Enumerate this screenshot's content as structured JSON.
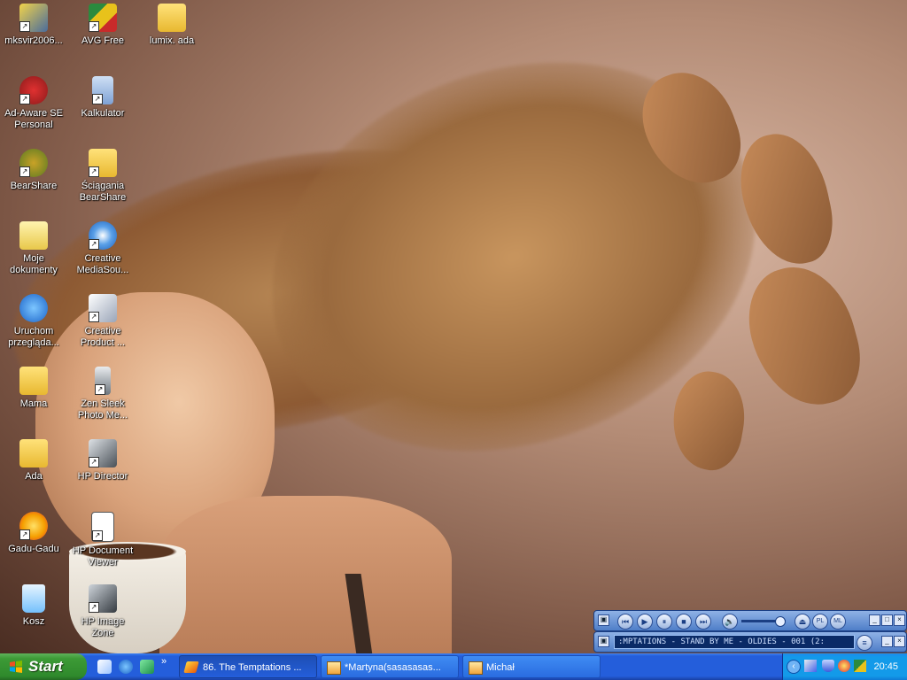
{
  "desktop_icons": [
    {
      "id": "mksvir",
      "label": "mksvir2006...",
      "icon": "mksvir-icon"
    },
    {
      "id": "avg",
      "label": "AVG Free",
      "icon": "avg-icon"
    },
    {
      "id": "lumix",
      "label": "lumix. ada",
      "icon": "folder-icon"
    },
    {
      "id": "adaware",
      "label": "Ad-Aware SE Personal",
      "icon": "adaware-icon"
    },
    {
      "id": "kalkulator",
      "label": "Kalkulator",
      "icon": "calculator-icon"
    },
    {
      "id": "bearshare",
      "label": "BearShare",
      "icon": "bearshare-icon"
    },
    {
      "id": "sciagania",
      "label": "Ściągania BearShare",
      "icon": "bearshare-folder-icon"
    },
    {
      "id": "moje",
      "label": "Moje dokumenty",
      "icon": "documents-folder-icon"
    },
    {
      "id": "creative_media",
      "label": "Creative MediaSou...",
      "icon": "creative-mediasource-icon"
    },
    {
      "id": "ie",
      "label": "Uruchom przeglądа...",
      "icon": "internet-explorer-icon"
    },
    {
      "id": "creative_product",
      "label": "Creative Product ...",
      "icon": "creative-product-icon"
    },
    {
      "id": "mama",
      "label": "Mama",
      "icon": "folder-icon"
    },
    {
      "id": "zen",
      "label": "Zen Sleek Photo Me...",
      "icon": "zen-photo-icon"
    },
    {
      "id": "ada",
      "label": "Ada",
      "icon": "folder-icon"
    },
    {
      "id": "hpdirector",
      "label": "HP Director",
      "icon": "hp-director-icon"
    },
    {
      "id": "gadu",
      "label": "Gadu-Gadu",
      "icon": "gadu-gadu-icon"
    },
    {
      "id": "hpdoc",
      "label": "HP Document Viewer",
      "icon": "hp-document-viewer-icon"
    },
    {
      "id": "kosz",
      "label": "Kosz",
      "icon": "recycle-bin-icon"
    },
    {
      "id": "hpimage",
      "label": "HP Image Zone",
      "icon": "hp-image-zone-icon"
    }
  ],
  "media_player": {
    "now_playing": ":MPTATIONS - STAND BY ME - OLDIES - 001 (2:",
    "controls": [
      "previous",
      "play",
      "pause",
      "stop",
      "next",
      "mute",
      "eject",
      "PL",
      "ML"
    ]
  },
  "taskbar": {
    "start_label": "Start",
    "quick_launch_more": "»",
    "tasks": [
      {
        "label": "86. The Temptations ...",
        "icon": "winamp-icon",
        "active": true
      },
      {
        "label": "*Martyna(sasasasas...",
        "icon": "mail-icon",
        "active": false
      },
      {
        "label": "Michał",
        "icon": "mail-icon",
        "active": false
      }
    ],
    "clock": "20:45"
  },
  "colors": {
    "taskbar_blue": "#245edb",
    "start_green": "#3c9a36",
    "tray_blue": "#139ae9"
  }
}
